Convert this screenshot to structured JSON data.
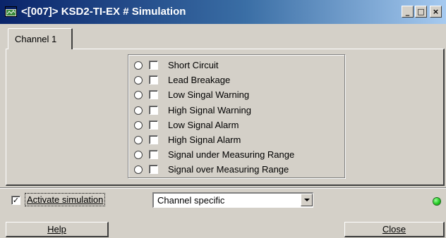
{
  "window": {
    "title": "<[007]> KSD2-TI-EX # Simulation",
    "icon": "app-window-icon",
    "minimize_glyph": "_",
    "maximize_glyph": "□",
    "close_glyph": "×"
  },
  "tabs": [
    {
      "label": "Channel 1",
      "accelerator": "1",
      "selected": true
    }
  ],
  "options": [
    {
      "label": "Short Circuit",
      "radio": false,
      "checked": false
    },
    {
      "label": "Lead Breakage",
      "radio": false,
      "checked": false
    },
    {
      "label": "Low Singal Warning",
      "radio": false,
      "checked": false
    },
    {
      "label": "High Signal Warning",
      "radio": false,
      "checked": false
    },
    {
      "label": "Low Signal Alarm",
      "radio": false,
      "checked": false
    },
    {
      "label": "High Signal Alarm",
      "radio": false,
      "checked": false
    },
    {
      "label": "Signal under Measuring Range",
      "radio": false,
      "checked": false
    },
    {
      "label": "Signal over Measuring Range",
      "radio": false,
      "checked": false
    }
  ],
  "activate": {
    "label": "Activate simulation",
    "checked": true,
    "check_glyph": "✓"
  },
  "mode_select": {
    "value": "Channel specific"
  },
  "status": {
    "led_color": "#22cc22",
    "led_icon": "status-led-icon"
  },
  "buttons": {
    "help": "Help",
    "close": "Close"
  },
  "colors": {
    "title_start": "#0a246a",
    "title_end": "#a6caf0",
    "face": "#d4d0c8"
  }
}
